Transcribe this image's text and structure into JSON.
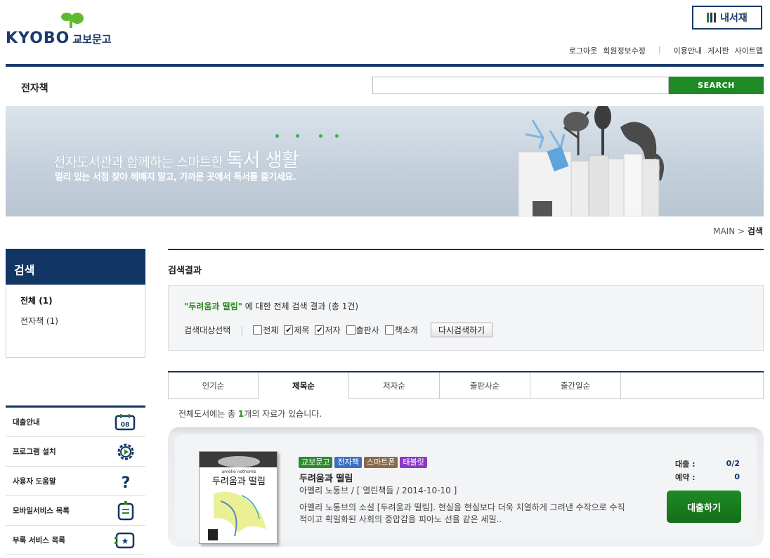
{
  "header": {
    "logo_text": "KYOBO",
    "logo_ko": "교보문고",
    "mylibrary_label": "내서재",
    "top_links_left": [
      "로그아웃",
      "회원정보수정"
    ],
    "top_links_right": [
      "이용안내",
      "게시판",
      "사이트맵"
    ],
    "section_title": "전자책",
    "search": {
      "value": "",
      "button_label": "SEARCH"
    }
  },
  "banner": {
    "title_small": "전자도서관과 함께하는 스마트한",
    "title_big": "독서 생활",
    "subtitle": "멀리 있는 서점 찾아 헤매지 말고, 가까운 곳에서 독서를 즐기세요."
  },
  "breadcrumb": {
    "home": "MAIN",
    "sep": ">",
    "current": "검색"
  },
  "sidebar": {
    "title": "검색",
    "categories": [
      {
        "label": "전체 (1)",
        "active": true
      },
      {
        "label": "전자책 (1)",
        "active": false
      }
    ],
    "menu": [
      {
        "label": "대출안내",
        "icon": "calendar-icon",
        "icon_text": "08"
      },
      {
        "label": "프로그램 설치",
        "icon": "gear-icon"
      },
      {
        "label": "사용자 도움말",
        "icon": "help-icon"
      },
      {
        "label": "모바일서비스 목록",
        "icon": "mobile-icon"
      },
      {
        "label": "부록 서비스 목록",
        "icon": "star-icon"
      }
    ]
  },
  "main": {
    "title": "검색결과",
    "query": "\"두려움과 떨림\"",
    "query_suffix": "에 대한 전체 검색 결과 (총 1건)",
    "filter_label": "검색대상선택",
    "filters": [
      {
        "label": "전체",
        "checked": false
      },
      {
        "label": "제목",
        "checked": true
      },
      {
        "label": "저자",
        "checked": true
      },
      {
        "label": "출판사",
        "checked": false
      },
      {
        "label": "책소개",
        "checked": false
      }
    ],
    "research_button": "다시검색하기",
    "tabs": [
      {
        "label": "인기순",
        "active": false
      },
      {
        "label": "제목순",
        "active": true
      },
      {
        "label": "저자순",
        "active": false
      },
      {
        "label": "출판사순",
        "active": false
      },
      {
        "label": "출간일순",
        "active": false
      }
    ],
    "count_prefix": "전체도서에는 총 ",
    "count_value": "1",
    "count_suffix": "개의 자료가 있습니다."
  },
  "book": {
    "badges": [
      {
        "label": "교보문고",
        "color": "#2e8b2e"
      },
      {
        "label": "전자책",
        "color": "#3a6fc4"
      },
      {
        "label": "스마트폰",
        "color": "#8a6a4a"
      },
      {
        "label": "태블릿",
        "color": "#8a3ac4"
      }
    ],
    "title": "두려움과 떨림",
    "meta": "아멜리 노통브 / [ 열린책들 / 2014-10-10 ]",
    "description": "아멜리 노통브의 소설 [두려움과 떨림]. 현실을 현실보다 더욱 치열하게 그려낸 수작으로 수직적이고 획일화된 사회의 중압감을 피아노 선율 같은 세밀..",
    "cover_author": "amélie nothomb",
    "cover_title": "두려움과 떨림",
    "loan_label": "대출 :",
    "loan_value": "0/2",
    "reserve_label": "예약 :",
    "reserve_value": "0",
    "loan_button": "대출하기"
  },
  "colors": {
    "navy": "#113565",
    "green": "#1f8a25"
  }
}
